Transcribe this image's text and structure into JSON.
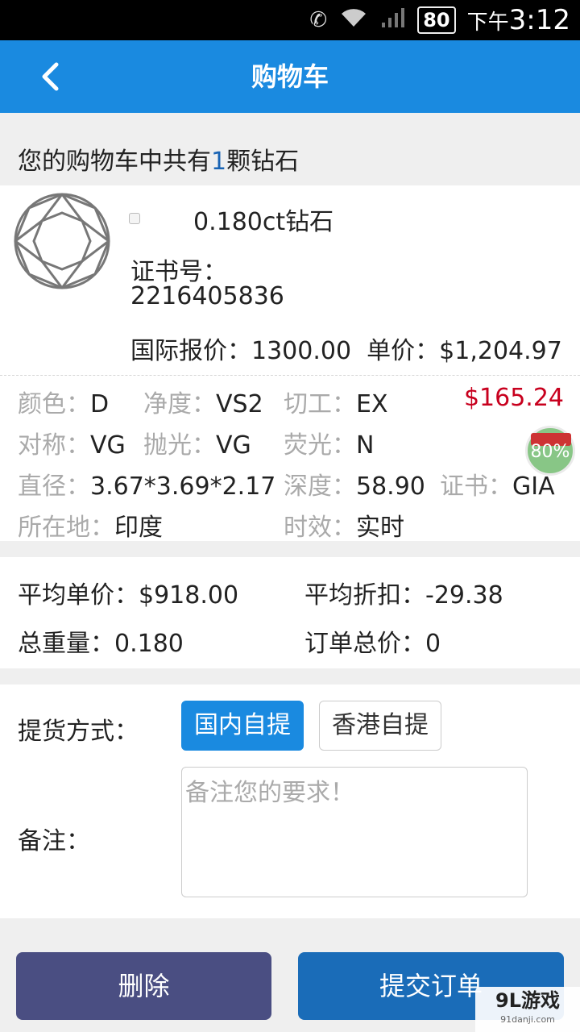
{
  "status_bar": {
    "battery": "80",
    "ampm": "下午",
    "time": "3:12",
    "icons": [
      "missed-call-icon",
      "wifi-icon",
      "signal-icon",
      "battery-icon"
    ]
  },
  "header": {
    "title": "购物车",
    "back_icon": "chevron-left-icon"
  },
  "cart": {
    "summary_prefix": "您的购物车中共有",
    "count": "1",
    "summary_suffix": "颗钻石"
  },
  "item": {
    "name": "0.180ct钻石",
    "cert_label": "证书号：",
    "cert_no": "2216405836",
    "list_price_label": "国际报价：",
    "list_price": "1300.00",
    "unit_price_label": "单价：",
    "unit_price": "$1,204.97",
    "total_price": "$165.24",
    "specs": {
      "color_k": "颜色：",
      "color_v": "D",
      "clarity_k": "净度：",
      "clarity_v": "VS2",
      "cut_k": "切工：",
      "cut_v": "EX",
      "symmetry_k": "对称：",
      "symmetry_v": "VG",
      "polish_k": "抛光：",
      "polish_v": "VG",
      "fluor_k": "荧光：",
      "fluor_v": "N",
      "diameter_k": "直径：",
      "diameter_v": "3.67*3.69*2.17",
      "depth_k": "深度：",
      "depth_v": "58.90",
      "cert_k": "证书：",
      "cert_v": "GIA",
      "location_k": "所在地：",
      "location_v": "印度",
      "time_k": "时效：",
      "time_v": "实时"
    }
  },
  "float_ball": {
    "percent": "80%"
  },
  "totals": {
    "avg_unit_label": "平均单价：",
    "avg_unit": "$918.00",
    "avg_discount_label": "平均折扣：",
    "avg_discount": "-29.38",
    "total_weight_label": "总重量：",
    "total_weight": "0.180",
    "order_total_label": "订单总价：",
    "order_total": "0"
  },
  "form": {
    "pickup_label": "提货方式：",
    "pickup_options": [
      "国内自提",
      "香港自提"
    ],
    "note_label": "备注：",
    "note_placeholder": "备注您的要求！"
  },
  "actions": {
    "delete": "删除",
    "submit": "提交订单"
  },
  "watermark": {
    "main": "9L游戏",
    "sub": "91danji.com"
  },
  "colors": {
    "primary": "#1a8ae0",
    "price_red": "#c8001e",
    "delete_btn": "#4a4e82",
    "submit_btn": "#1a6cb8"
  }
}
